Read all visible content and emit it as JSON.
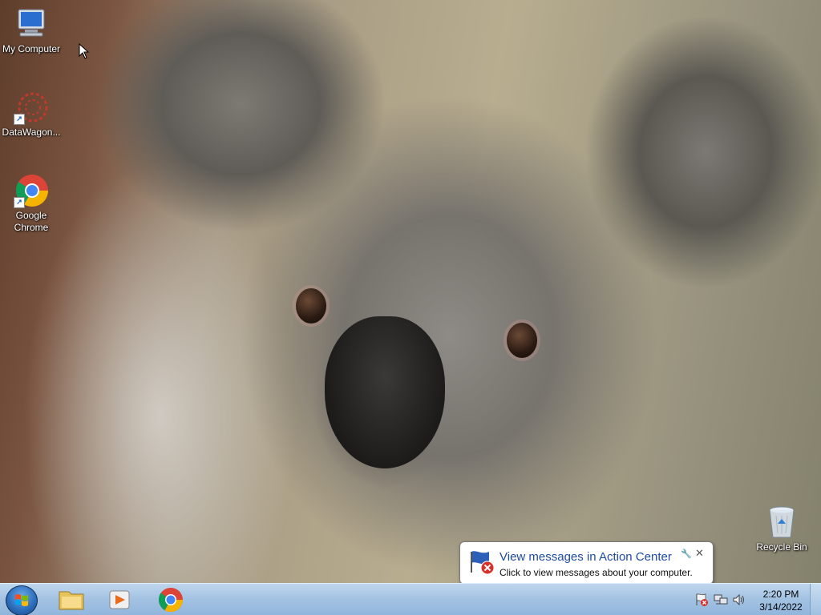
{
  "desktop": {
    "icons": [
      {
        "label": "My Computer",
        "icon": "computer-icon"
      },
      {
        "label": "DataWagon...",
        "icon": "datawagon-icon"
      },
      {
        "label": "Google Chrome",
        "icon": "chrome-icon"
      },
      {
        "label": "Recycle Bin",
        "icon": "recycle-bin-icon"
      }
    ]
  },
  "notification": {
    "title": "View messages in Action Center",
    "message": "Click to view messages about your computer.",
    "icon": "action-center-flag-icon"
  },
  "taskbar": {
    "apps": [
      {
        "name": "explorer",
        "icon": "folder-icon"
      },
      {
        "name": "media-player",
        "icon": "media-player-icon"
      },
      {
        "name": "chrome",
        "icon": "chrome-icon"
      }
    ],
    "clock": {
      "time": "2:20 PM",
      "date": "3/14/2022"
    }
  },
  "colors": {
    "taskbar": "#a4c3e3",
    "link_blue": "#1e4ba6"
  }
}
